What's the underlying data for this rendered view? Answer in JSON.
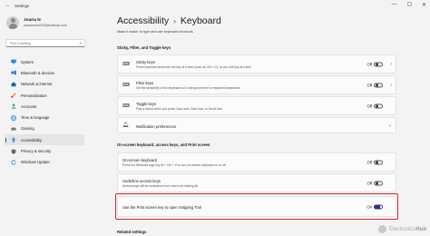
{
  "window": {
    "title": "Settings",
    "controls": [
      "—",
      "☐",
      "✕"
    ]
  },
  "user": {
    "name": "Joana N",
    "email": "joananuria2020@outlook.com"
  },
  "search": {
    "placeholder": "Find a setting"
  },
  "nav": [
    {
      "label": "System",
      "icon": "system-icon",
      "color": "#1e88e5"
    },
    {
      "label": "Bluetooth & devices",
      "icon": "bluetooth-icon",
      "color": "#1e88e5"
    },
    {
      "label": "Network & internet",
      "icon": "network-icon",
      "color": "#1565c0"
    },
    {
      "label": "Personalization",
      "icon": "brush-icon",
      "color": "#e07a2e"
    },
    {
      "label": "Accounts",
      "icon": "accounts-icon",
      "color": "#2e9e5b"
    },
    {
      "label": "Time & language",
      "icon": "globe-icon",
      "color": "#1e88e5"
    },
    {
      "label": "Gaming",
      "icon": "gaming-icon",
      "color": "#666666"
    },
    {
      "label": "Accessibility",
      "icon": "accessibility-icon",
      "color": "#1565c0",
      "active": true
    },
    {
      "label": "Privacy & security",
      "icon": "shield-icon",
      "color": "#666666"
    },
    {
      "label": "Windows Update",
      "icon": "update-icon",
      "color": "#1e88e5"
    }
  ],
  "header": {
    "parent": "Accessibility",
    "separator": "›",
    "current": "Keyboard",
    "subtitle": "Make it easier to type and use keyboard shortcuts"
  },
  "sections": {
    "sticky_filter_toggle": "Sticky, Filter, and Toggle keys",
    "onscreen": "On-screen keyboard, access keys, and Print screen",
    "related": "Related settings"
  },
  "settings": {
    "sticky": {
      "title": "Sticky keys",
      "desc": "Press keyboard shortcuts one key at a time (such as Ctrl + C), or use a ⊞ key at a time",
      "state": "Off"
    },
    "filter": {
      "title": "Filter keys",
      "desc": "Set the sensitivity of the keyboard so it can ignore brief or repeated keystrokes",
      "state": "Off"
    },
    "toggle": {
      "title": "Toggle keys",
      "desc": "Play a sound when you press Caps lock, Num lock, or Scroll lock",
      "state": "Off"
    },
    "notification": {
      "title": "Notification preferences"
    },
    "osk": {
      "title": "On-screen keyboard",
      "desc": "Press the Windows logo key ⊞ + Ctrl + O to turn on-screen keyboard on or off",
      "state": "Off"
    },
    "underline": {
      "title": "Underline access keys",
      "desc": "Access keys will be underlined even when not holding Alt",
      "state": "Off"
    },
    "printscreen": {
      "title": "Use the Print screen key to open Snipping Tool",
      "state": "On"
    }
  },
  "watermark": {
    "brand": "Electronics",
    "suffix": "Hub"
  },
  "colors": {
    "accent": "#3b2d84",
    "highlight": "#d6262a",
    "active_indicator": "#0067c0"
  }
}
